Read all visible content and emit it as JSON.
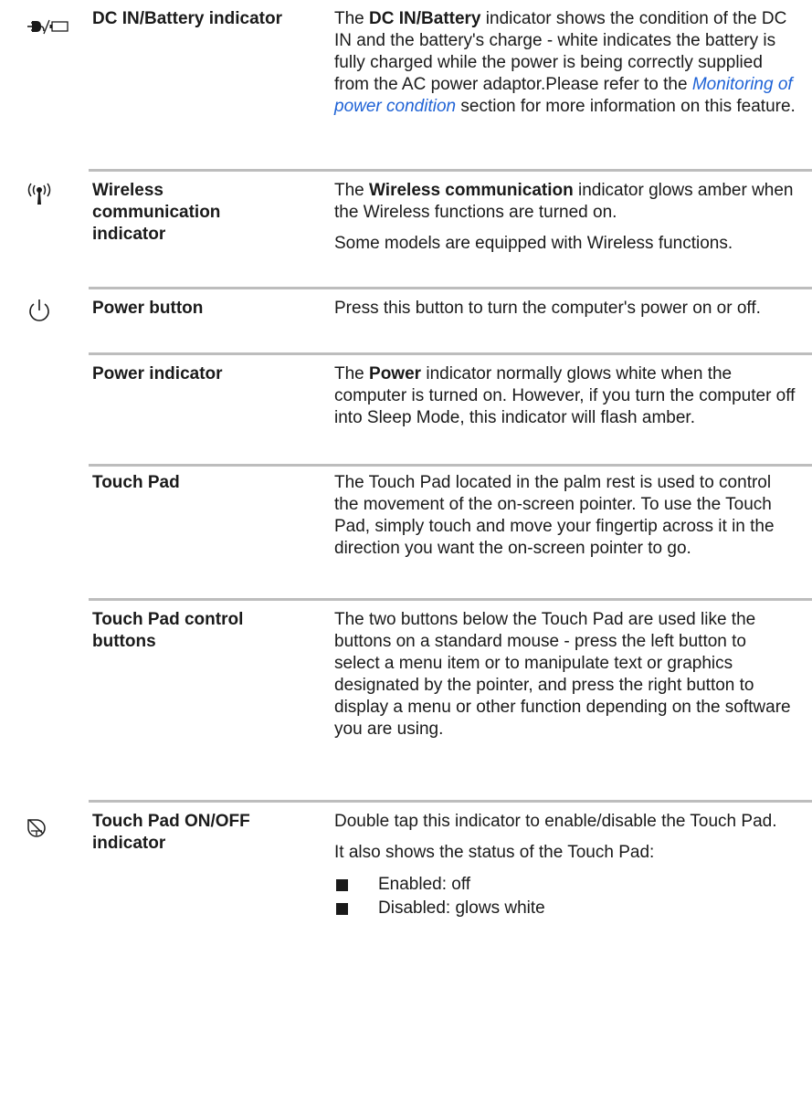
{
  "rows": [
    {
      "icon": "dc-in-battery-icon",
      "term": "DC IN/Battery indicator",
      "desc": {
        "p1_bold1": "DC IN/Battery",
        "p1_text1": " indicator shows the condition of the DC IN and the battery's charge - white indicates the battery is fully charged while the power is being correctly supplied from the AC power adaptor.Please refer to the ",
        "p1_pre": "The ",
        "p1_link": "Monitoring of power condition",
        "p1_text2": " section for more information on this feature."
      }
    },
    {
      "icon": "wireless-icon",
      "term": "Wireless communication indicator",
      "desc": {
        "p1_pre": "The ",
        "p1_bold": "Wireless communication",
        "p1_text": " indicator glows amber when the Wireless functions are turned on.",
        "p2": "Some models are equipped with Wireless functions."
      }
    },
    {
      "icon": "power-icon",
      "term": "Power button",
      "desc": {
        "p1": "Press this button to turn the computer's power on or off."
      }
    },
    {
      "term": "Power indicator",
      "desc": {
        "p1_pre": "The ",
        "p1_bold": "Power",
        "p1_text": " indicator normally glows white when the computer is turned on. However, if you turn the computer off into Sleep Mode, this indicator will flash amber."
      }
    },
    {
      "term": "Touch Pad",
      "desc": {
        "p1": "The Touch Pad located in the palm rest is used to control the movement of the on-screen pointer. To use the Touch Pad, simply touch and move your fingertip across it in the direction you want the on-screen pointer to go."
      }
    },
    {
      "term": "Touch Pad control buttons",
      "desc": {
        "p1": "The two buttons below the Touch Pad are used like the buttons on a standard mouse - press the left button to select a menu item or to manipulate text or graphics designated by the pointer, and press the right button to display a menu or other function depending on the software you are using."
      }
    },
    {
      "icon": "touchpad-icon",
      "term": "Touch Pad ON/OFF indicator",
      "desc": {
        "p1": "Double tap this indicator to enable/disable the Touch Pad.",
        "p2": "It also shows the status of the Touch Pad:",
        "bullets": [
          "Enabled: off",
          "Disabled: glows white"
        ]
      }
    }
  ]
}
